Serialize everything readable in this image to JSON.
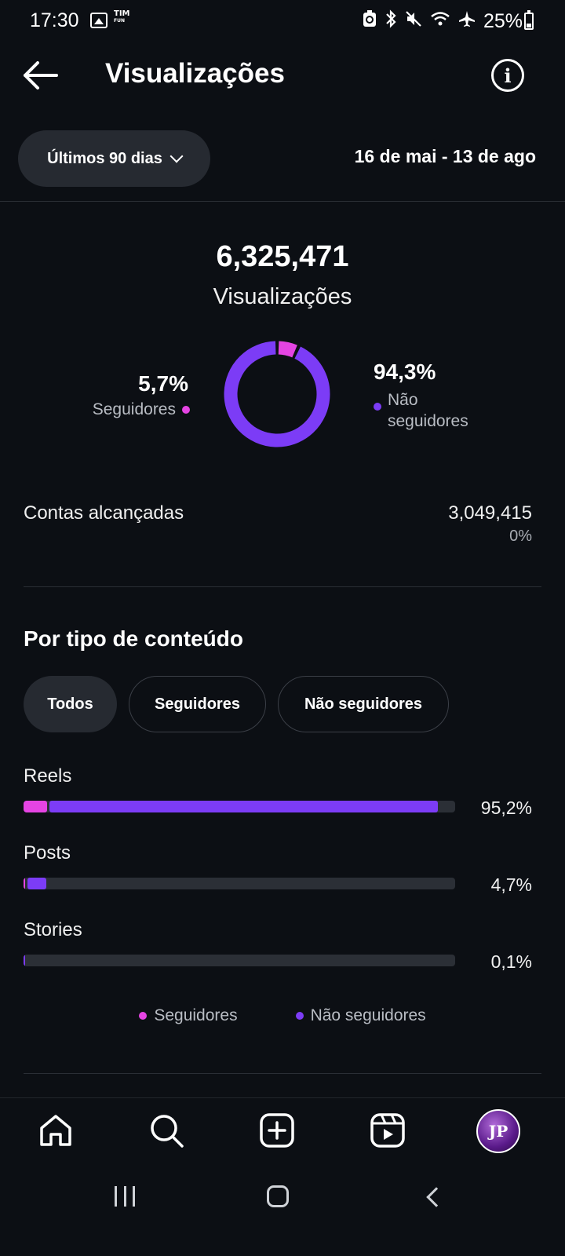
{
  "status_bar": {
    "time": "17:30",
    "carrier": "TIM",
    "carrier_sub": "FUN",
    "battery": "25%"
  },
  "header": {
    "title": "Visualizações",
    "back_icon": "arrow-left-icon",
    "info_icon": "info-icon"
  },
  "filter": {
    "range_label": "Últimos 90 dias",
    "date_range": "16 de mai - 13 de ago"
  },
  "summary": {
    "total_views": "6,325,471",
    "total_label": "Visualizações",
    "followers_pct": "5,7%",
    "followers_label": "Seguidores",
    "non_followers_pct": "94,3%",
    "non_followers_label_line1": "Não",
    "non_followers_label_line2": "seguidores",
    "followers_fraction": 0.057,
    "non_followers_fraction": 0.943
  },
  "reach": {
    "label": "Contas alcançadas",
    "value": "3,049,415",
    "change": "0%"
  },
  "content_type": {
    "title": "Por tipo de conteúdo",
    "chips": [
      "Todos",
      "Seguidores",
      "Não seguidores"
    ],
    "active_chip": "Todos",
    "rows": [
      {
        "label": "Reels",
        "pct": "95,2%",
        "followers": 0.055,
        "non_followers": 0.9
      },
      {
        "label": "Posts",
        "pct": "4,7%",
        "followers": 0.004,
        "non_followers": 0.043
      },
      {
        "label": "Stories",
        "pct": "0,1%",
        "followers": 0.0,
        "non_followers": 0.001
      }
    ],
    "legend": {
      "followers": "Seguidores",
      "non_followers": "Não seguidores"
    }
  },
  "colors": {
    "followers": "#e544e3",
    "non_followers": "#7c3cf6",
    "background": "#0c0f14"
  },
  "bottom_nav": {
    "items": [
      "home-icon",
      "search-icon",
      "create-icon",
      "reels-icon",
      "profile-avatar"
    ],
    "avatar_initials": "JP"
  }
}
